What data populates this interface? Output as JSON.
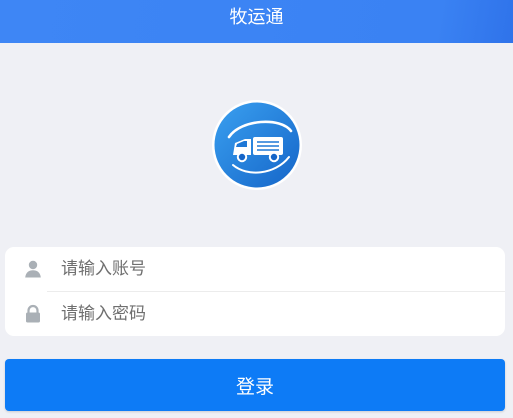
{
  "header": {
    "title": "牧运通"
  },
  "logo": {
    "icon": "truck-logo-icon"
  },
  "form": {
    "username": {
      "icon": "user-icon",
      "value": "",
      "placeholder": "请输入账号"
    },
    "password": {
      "icon": "lock-icon",
      "value": "",
      "placeholder": "请输入密码"
    }
  },
  "login": {
    "label": "登录"
  },
  "colors": {
    "header": "#3e86f5",
    "background": "#eff0f5",
    "button": "#0d7bf6",
    "icon": "#aab0b6"
  }
}
